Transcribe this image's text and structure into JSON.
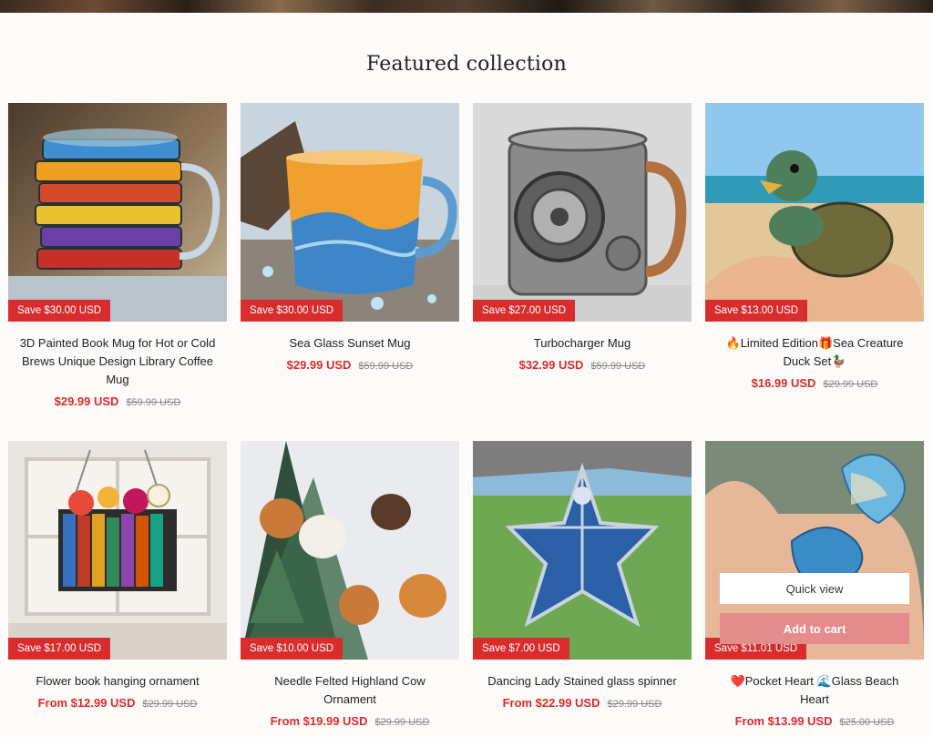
{
  "section": {
    "heading": "Featured collection"
  },
  "products": [
    {
      "title": "3D Painted Book Mug for Hot or Cold Brews Unique Design Library Coffee Mug",
      "price": "$29.99 USD",
      "compare": "$59.99 USD",
      "badge": "Save $30.00 USD"
    },
    {
      "title": "Sea Glass Sunset Mug",
      "price": "$29.99 USD",
      "compare": "$59.99 USD",
      "badge": "Save $30.00 USD"
    },
    {
      "title": "Turbocharger Mug",
      "price": "$32.99 USD",
      "compare": "$59.99 USD",
      "badge": "Save $27.00 USD"
    },
    {
      "title": "🔥Limited Edition🎁Sea Creature Duck Set🦆",
      "price": "$16.99 USD",
      "compare": "$29.99 USD",
      "badge": "Save $13.00 USD"
    },
    {
      "title": "Flower book hanging ornament",
      "price": "From $12.99 USD",
      "compare": "$29.99 USD",
      "badge": "Save $17.00 USD"
    },
    {
      "title": "Needle Felted Highland Cow Ornament",
      "price": "From $19.99 USD",
      "compare": "$29.99 USD",
      "badge": "Save $10.00 USD"
    },
    {
      "title": "Dancing Lady Stained glass spinner",
      "price": "From $22.99 USD",
      "compare": "$29.99 USD",
      "badge": "Save $7.00 USD"
    },
    {
      "title": "❤️Pocket Heart 🌊Glass Beach Heart",
      "price": "From $13.99 USD",
      "compare": "$25.00 USD",
      "badge": "Save $11.01 USD",
      "quick_view": "Quick view",
      "add_to_cart": "Add to cart"
    }
  ]
}
